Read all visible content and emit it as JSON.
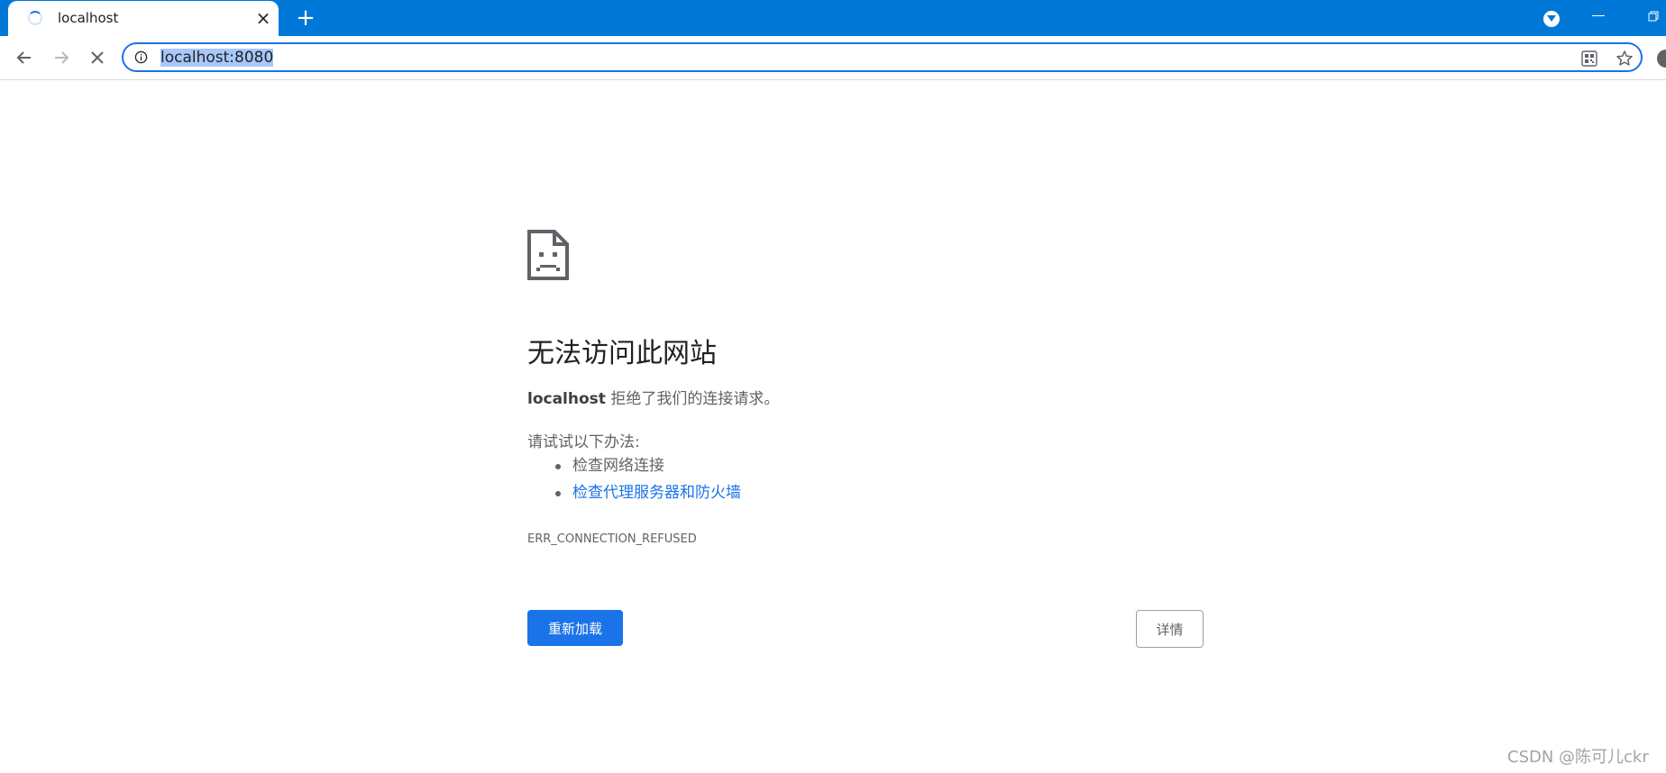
{
  "tab": {
    "title": "localhost",
    "close_label": "×",
    "new_tab_label": "+"
  },
  "toolbar": {
    "url": "localhost:8080"
  },
  "error": {
    "heading": "无法访问此网站",
    "host": "localhost",
    "summary_rest": " 拒绝了我们的连接请求。",
    "suggestions_intro": "请试试以下办法:",
    "suggestions": [
      "检查网络连接",
      "检查代理服务器和防火墙"
    ],
    "code": "ERR_CONNECTION_REFUSED",
    "reload_label": "重新加载",
    "details_label": "详情"
  },
  "watermark": "CSDN @陈可儿ckr",
  "colors": {
    "tabstrip": "#0078d7",
    "accent": "#1a73e8",
    "link": "#1a73e8",
    "text_secondary": "#5f6368"
  }
}
